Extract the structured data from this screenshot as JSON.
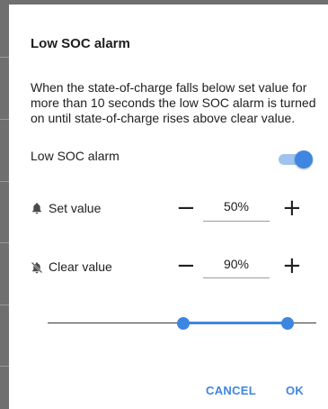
{
  "dialog": {
    "title": "Low SOC alarm",
    "description": "When the state-of-charge falls below set value for more than 10 seconds the low SOC alarm is turned on until state-of-charge rises above clear value."
  },
  "alarm_toggle": {
    "label": "Low SOC alarm",
    "enabled": true
  },
  "set_value": {
    "label": "Set value",
    "value": "50%",
    "minus": "−",
    "plus": "+",
    "icon": "bell-icon"
  },
  "clear_value": {
    "label": "Clear value",
    "value": "90%",
    "minus": "−",
    "plus": "+",
    "icon": "bell-off-icon"
  },
  "range_slider": {
    "low": 50,
    "high": 90
  },
  "actions": {
    "cancel": "CANCEL",
    "ok": "OK"
  },
  "colors": {
    "accent": "#3d86e0",
    "switch_track": "#9fc2ee"
  }
}
